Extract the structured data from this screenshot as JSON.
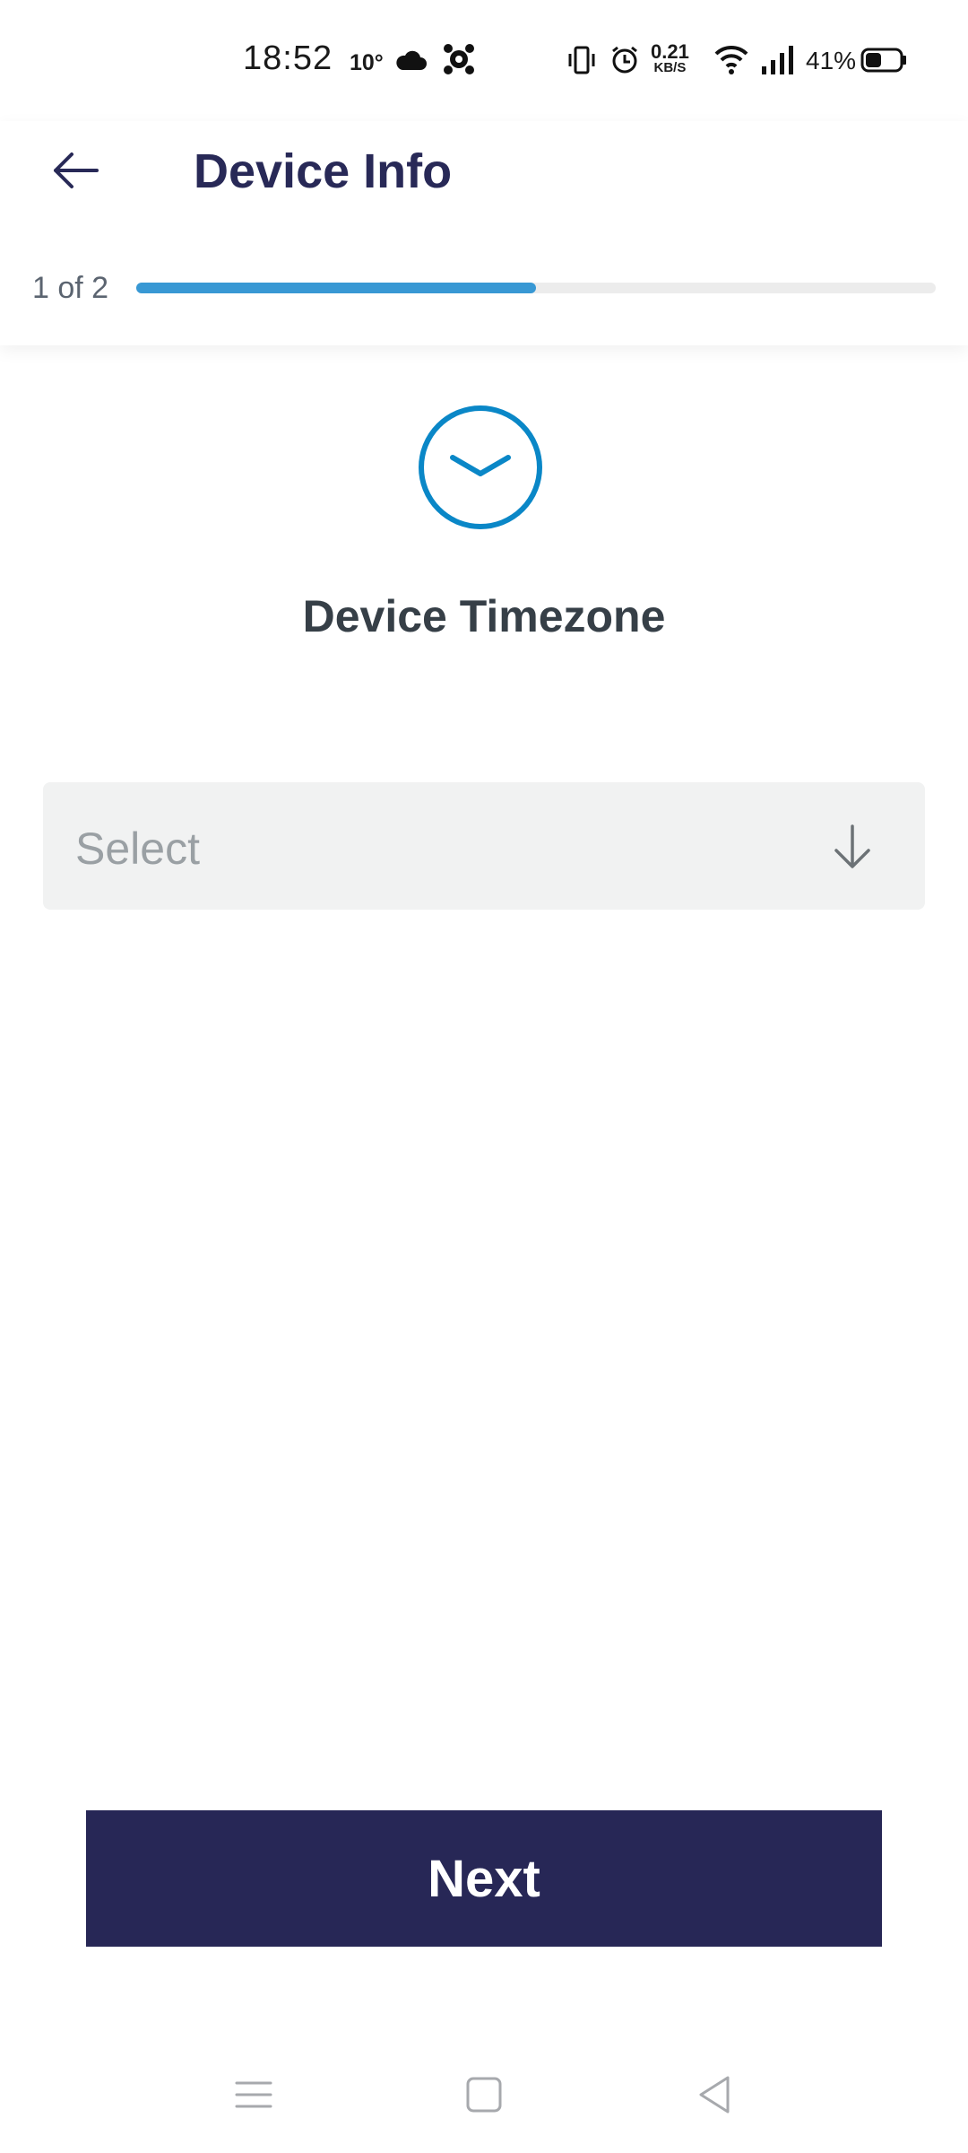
{
  "status_bar": {
    "time": "18:52",
    "temperature": "10°",
    "net_speed_value": "0.21",
    "net_speed_unit": "KB/S",
    "battery_percent": "41%"
  },
  "header": {
    "title": "Device Info",
    "step_label": "1 of 2",
    "progress_fraction": 0.5,
    "progress_color": "#3898d4"
  },
  "main": {
    "icon": "clock-icon",
    "heading": "Device Timezone",
    "timezone_select": {
      "placeholder": "Select"
    }
  },
  "footer": {
    "next_label": "Next",
    "button_color": "#272756"
  },
  "system_nav": {
    "icons": [
      "menu-icon",
      "home-icon",
      "back-icon"
    ]
  }
}
